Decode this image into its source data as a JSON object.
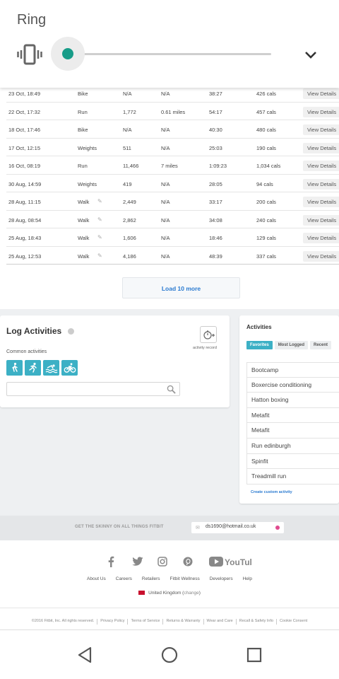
{
  "ring": {
    "title": "Ring",
    "volume_level": 0.0
  },
  "table": {
    "rows": [
      {
        "date": "23 Oct, 18:49",
        "activity": "Bike",
        "steps": "N/A",
        "distance": "N/A",
        "duration": "38:27",
        "calories": "426 cals",
        "view": "View Details",
        "editable": false
      },
      {
        "date": "22 Oct, 17:32",
        "activity": "Run",
        "steps": "1,772",
        "distance": "0.61 miles",
        "duration": "54:17",
        "calories": "457 cals",
        "view": "View Details",
        "editable": false
      },
      {
        "date": "18 Oct, 17:46",
        "activity": "Bike",
        "steps": "N/A",
        "distance": "N/A",
        "duration": "40:30",
        "calories": "480 cals",
        "view": "View Details",
        "editable": false
      },
      {
        "date": "17 Oct, 12:15",
        "activity": "Weights",
        "steps": "511",
        "distance": "N/A",
        "duration": "25:03",
        "calories": "190 cals",
        "view": "View Details",
        "editable": false
      },
      {
        "date": "16 Oct, 08:19",
        "activity": "Run",
        "steps": "11,466",
        "distance": "7 miles",
        "duration": "1:09:23",
        "calories": "1,034 cals",
        "view": "View Details",
        "editable": false
      },
      {
        "date": "30 Aug, 14:59",
        "activity": "Weights",
        "steps": "419",
        "distance": "N/A",
        "duration": "28:05",
        "calories": "94 cals",
        "view": "View Details",
        "editable": false
      },
      {
        "date": "28 Aug, 11:15",
        "activity": "Walk",
        "steps": "2,449",
        "distance": "N/A",
        "duration": "33:17",
        "calories": "200 cals",
        "view": "View Details",
        "editable": true
      },
      {
        "date": "28 Aug, 08:54",
        "activity": "Walk",
        "steps": "2,862",
        "distance": "N/A",
        "duration": "34:08",
        "calories": "240 cals",
        "view": "View Details",
        "editable": true
      },
      {
        "date": "25 Aug, 18:43",
        "activity": "Walk",
        "steps": "1,606",
        "distance": "N/A",
        "duration": "18:46",
        "calories": "129 cals",
        "view": "View Details",
        "editable": true
      },
      {
        "date": "25 Aug, 12:53",
        "activity": "Walk",
        "steps": "4,186",
        "distance": "N/A",
        "duration": "48:39",
        "calories": "337 cals",
        "view": "View Details",
        "editable": true
      }
    ],
    "load_more": "Load 10 more"
  },
  "log": {
    "title": "Log Activities",
    "record_label": "activity record",
    "common_label": "Common activities",
    "common_icons": [
      "walk-icon",
      "run-icon",
      "swim-icon",
      "bike-icon"
    ],
    "search_placeholder": ""
  },
  "activities": {
    "title": "Activities",
    "tabs": [
      "Favorites",
      "Most Logged",
      "Recent"
    ],
    "active_tab": "Favorites",
    "items": [
      "Bootcamp",
      "Boxercise conditioning",
      "Hatton boxing",
      "Metafit",
      "Metafit",
      "Run edinburgh",
      "Spinfit",
      "Treadmill run"
    ],
    "create_link": "Create custom activity"
  },
  "newsletter": {
    "label": "GET THE SKINNY ON ALL THINGS FITBIT",
    "email": "ds1690@hotmail.co.uk"
  },
  "footer": {
    "social": [
      "facebook-icon",
      "twitter-icon",
      "instagram-icon",
      "pinterest-icon",
      "youtube-icon"
    ],
    "links": [
      "About Us",
      "Careers",
      "Retailers",
      "Fitbit Wellness",
      "Developers",
      "Help"
    ],
    "region": "United Kingdom",
    "change": "change",
    "legal": [
      "©2016 Fitbit, Inc. All rights reserved.",
      "Privacy Policy",
      "Terms of Service",
      "Returns & Warranty",
      "Wear and Care",
      "Recall & Safety Info",
      "Cookie Consent"
    ]
  },
  "colors": {
    "accent": "#179c88",
    "activity_icon": "#3cb0c5",
    "link": "#2a7ad0"
  }
}
